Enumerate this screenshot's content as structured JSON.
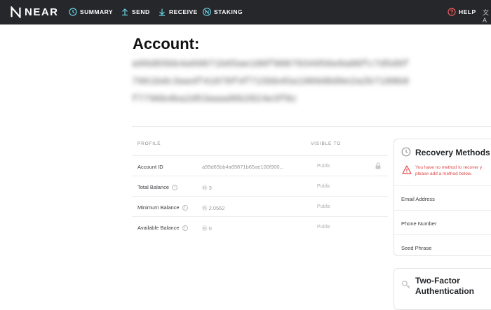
{
  "nav": {
    "logo": "NEAR",
    "items": [
      {
        "label": "SUMMARY",
        "icon": "clock-icon"
      },
      {
        "label": "SEND",
        "icon": "arrow-up-icon"
      },
      {
        "label": "RECEIVE",
        "icon": "arrow-down-icon"
      },
      {
        "label": "STAKING",
        "icon": "near-coin-icon"
      }
    ],
    "help": "HELP",
    "lang_icon": "translate-icon"
  },
  "account": {
    "title": "Account:",
    "id_blurred": "a99d65bb4a69871b65ae100f9007834956e8a00fc7d5d9f7961bdc3aa4f41870f4f715bb45a1909d0d9e2a2b7180b8f7796b4ba2d53aaad6b2824e3f0c"
  },
  "profile": {
    "header_profile": "PROFILE",
    "header_visible": "VISIBLE TO",
    "rows": [
      {
        "label": "Account ID",
        "value": "a99d65bb4a69871b65ae100f900...",
        "visibility": "Public",
        "lock": true,
        "info": false
      },
      {
        "label": "Total Balance",
        "value": "Ⓝ 3",
        "visibility": "Public",
        "lock": false,
        "info": true
      },
      {
        "label": "Minimum Balance",
        "value": "Ⓝ 2.0562",
        "visibility": "Public",
        "lock": false,
        "info": true
      },
      {
        "label": "Available Balance",
        "value": "Ⓝ 0",
        "visibility": "Public",
        "lock": false,
        "info": true
      }
    ]
  },
  "recovery": {
    "title": "Recovery Methods",
    "warning_line1": "You have no method to recover y",
    "warning_line2": "please add a method below.",
    "methods": [
      "Email Address",
      "Phone Number",
      "Seed Phrase"
    ]
  },
  "two_factor": {
    "title": "Two-Factor Authentication"
  },
  "colors": {
    "nav_bg": "#25272a",
    "accent_green": "#6ad1e3",
    "warning_red": "#e04848"
  }
}
